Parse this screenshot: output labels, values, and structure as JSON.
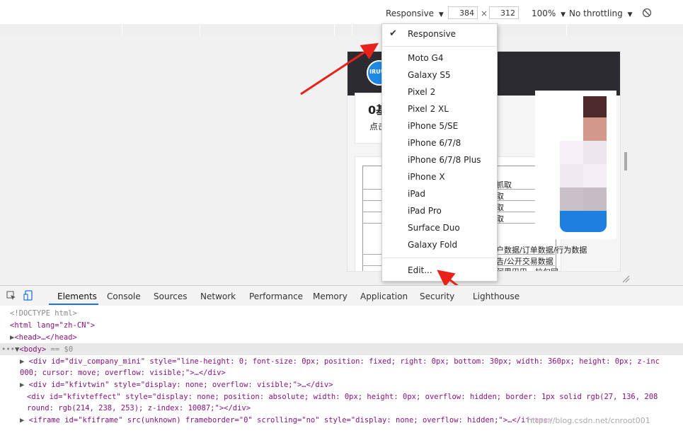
{
  "toolbar": {
    "device_label": "Responsive",
    "width_value": "384",
    "times": "×",
    "height_value": "312",
    "zoom_label": "100%",
    "throttle_label": "No throttling"
  },
  "menu": {
    "checkmark": "✔",
    "selected": "Responsive",
    "devices": [
      "Moto G4",
      "Galaxy S5",
      "Pixel 2",
      "Pixel 2 XL",
      "iPhone 5/SE",
      "iPhone 6/7/8",
      "iPhone 6/7/8 Plus",
      "iPhone X",
      "iPad",
      "iPad Pro",
      "Surface Duo",
      "Galaxy Fold"
    ],
    "edit": "Edit..."
  },
  "page": {
    "logo_text": "IRUU",
    "heading_partial": "0基",
    "sub_partial": "点击",
    "table_rows": [
      "抓取",
      "取",
      "取",
      "取",
      "户数据/订单数据/行为数据",
      "告/公开交易数据",
      "阿里巴巴、拉勾网"
    ]
  },
  "tabs": [
    "Elements",
    "Console",
    "Sources",
    "Network",
    "Performance",
    "Memory",
    "Application",
    "Security",
    "Lighthouse"
  ],
  "code": {
    "doctype": "<!DOCTYPE html>",
    "html_open": "<html lang=\"zh-CN\">",
    "head": "<head>…</head>",
    "body_tag": "<body>",
    "body_eq": " == $0",
    "line1a": "<div id=\"div_company_mini\" style=\"line-height: 0; font-size: 0px; position: fixed; right: 0px; bottom: 30px; width: 360px; height: 0px; z-inc",
    "line1b": "000; cursor: move; overflow: visible;\">…</div>",
    "line2": "<div id=\"kfivtwin\" style=\"display: none; overflow: visible;\">…</div>",
    "line3a": "<div id=\"kfivteffect\" style=\"display: none; position: absolute; width: 0px; height: 0px; overflow: hidden; border: 1px solid rgb(27, 136, 208",
    "line3b": "round: rgb(214, 238, 253); z-index: 10087;\"></div>",
    "line4": "<iframe id=\"kfiframe\" src(unknown) frameborder=\"0\" scrolling=\"no\" style=\"display: none; overflow: hidden;\">…</iframe>",
    "watermark": "https://blog.csdn.net/cnroot001"
  },
  "colors": {
    "accent": "#1a73e8",
    "arrow": "#e8221b",
    "circle": "#e8221b"
  }
}
